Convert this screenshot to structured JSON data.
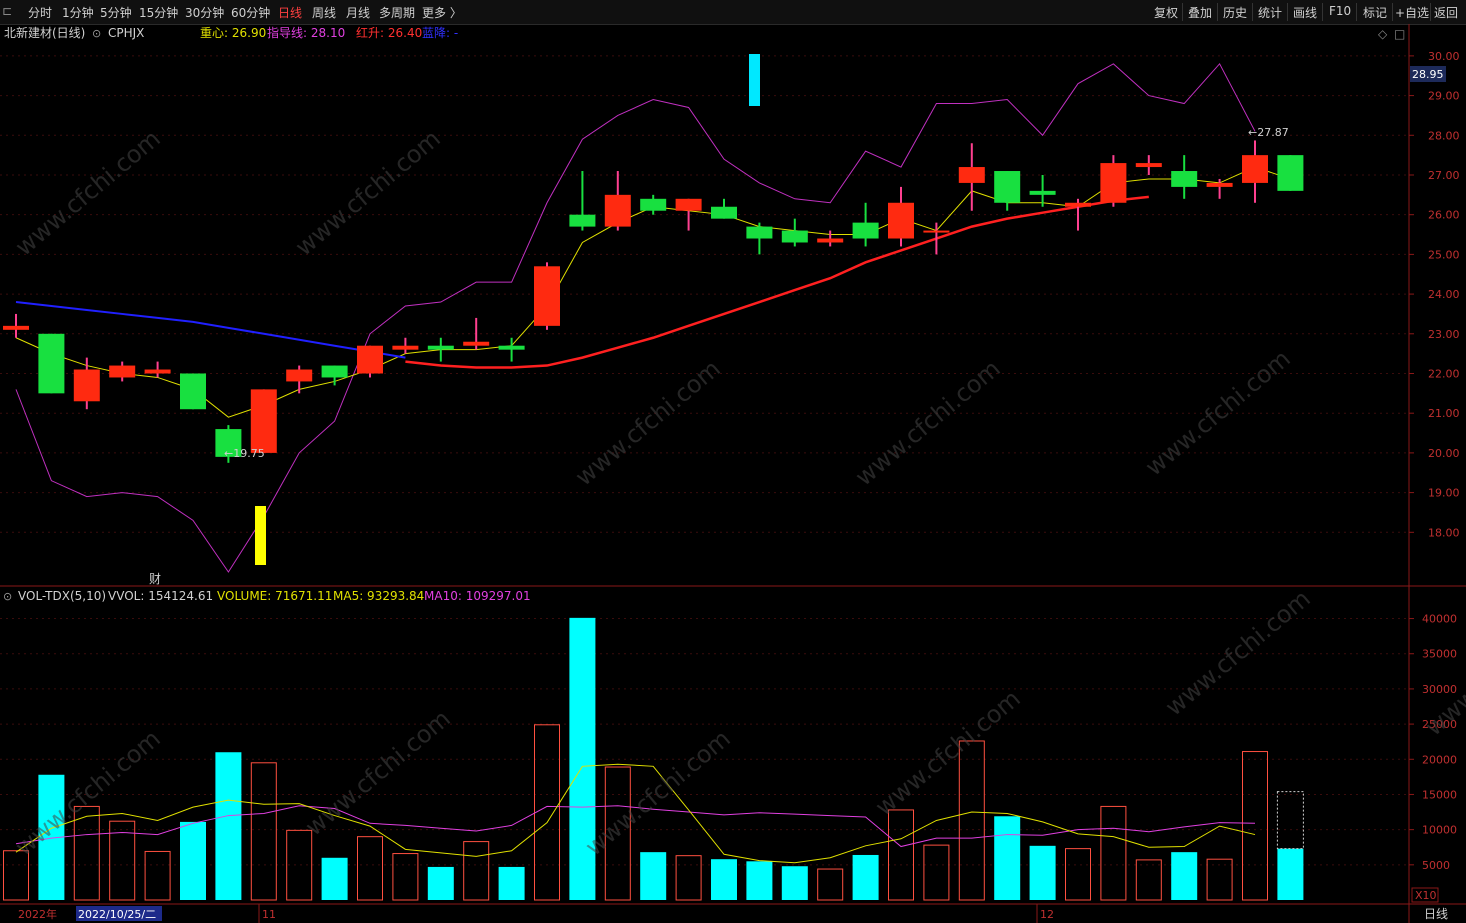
{
  "toolbar": {
    "periods": [
      "分时",
      "1分钟",
      "5分钟",
      "15分钟",
      "30分钟",
      "60分钟",
      "日线",
      "周线",
      "月线",
      "多周期",
      "更多 〉"
    ],
    "active_period": "日线",
    "right_buttons": [
      "复权",
      "叠加",
      "历史",
      "统计",
      "画线",
      "F10",
      "标记",
      "+自选",
      "返回"
    ]
  },
  "main_legend": {
    "stock_name": "北新建材(日线)",
    "indicator": "CPHJX",
    "items": [
      {
        "label": "重心: 26.90",
        "color": "#e0e000"
      },
      {
        "label": "指导线: 28.10",
        "color": "#e040e0"
      },
      {
        "label": "红升: 26.40",
        "color": "#ff3030"
      },
      {
        "label": "蓝降: -",
        "color": "#3030ff"
      }
    ]
  },
  "volume_legend": {
    "name": "VOL-TDX(5,10)",
    "items": [
      {
        "label": "VVOL: 154124.61",
        "color": "#d0d0d0"
      },
      {
        "label": "VOLUME: 71671.11",
        "color": "#e0e000"
      },
      {
        "label": "MA5: 93293.84",
        "color": "#e0e000"
      },
      {
        "label": "MA10: 109297.01",
        "color": "#e040e0"
      }
    ]
  },
  "price_axis": {
    "ticks": [
      "30.00",
      "29.00",
      "28.00",
      "27.00",
      "26.00",
      "25.00",
      "24.00",
      "23.00",
      "22.00",
      "21.00",
      "20.00",
      "19.00",
      "18.00"
    ],
    "current": "28.95"
  },
  "volume_axis": {
    "ticks": [
      "40000",
      "35000",
      "30000",
      "25000",
      "20000",
      "15000",
      "10000",
      "5000"
    ],
    "unit": "X10"
  },
  "date_axis": {
    "labels": [
      "2022年",
      "2022/10/25/二",
      "11",
      "12"
    ],
    "period_label": "日线"
  },
  "annotations": {
    "low": "←19.75",
    "high": "←27.87",
    "finance_marker": "财"
  },
  "watermark": "www.cfchi.com",
  "chart_data": {
    "type": "candlestick",
    "candles": [
      {
        "o": 23.1,
        "h": 23.5,
        "l": 22.9,
        "c": 23.2,
        "v": 7000
      },
      {
        "o": 23.0,
        "h": 23.0,
        "l": 21.5,
        "c": 21.5,
        "v": 17800
      },
      {
        "o": 21.3,
        "h": 22.4,
        "l": 21.1,
        "c": 22.1,
        "v": 13300
      },
      {
        "o": 21.9,
        "h": 22.3,
        "l": 21.8,
        "c": 22.2,
        "v": 11200
      },
      {
        "o": 22.0,
        "h": 22.3,
        "l": 21.9,
        "c": 22.1,
        "v": 6900
      },
      {
        "o": 22.0,
        "h": 22.0,
        "l": 21.1,
        "c": 21.1,
        "v": 11100
      },
      {
        "o": 20.6,
        "h": 20.7,
        "l": 19.75,
        "c": 19.9,
        "v": 21000
      },
      {
        "o": 20.0,
        "h": 21.6,
        "l": 20.0,
        "c": 21.6,
        "v": 19500
      },
      {
        "o": 21.8,
        "h": 22.2,
        "l": 21.5,
        "c": 22.1,
        "v": 9900
      },
      {
        "o": 22.2,
        "h": 22.2,
        "l": 21.7,
        "c": 21.9,
        "v": 6000
      },
      {
        "o": 22.0,
        "h": 22.7,
        "l": 21.9,
        "c": 22.7,
        "v": 9000
      },
      {
        "o": 22.6,
        "h": 22.9,
        "l": 22.5,
        "c": 22.7,
        "v": 6600
      },
      {
        "o": 22.7,
        "h": 22.9,
        "l": 22.3,
        "c": 22.6,
        "v": 4700
      },
      {
        "o": 22.7,
        "h": 23.4,
        "l": 22.6,
        "c": 22.8,
        "v": 8300
      },
      {
        "o": 22.7,
        "h": 22.9,
        "l": 22.3,
        "c": 22.6,
        "v": 4700
      },
      {
        "o": 23.2,
        "h": 24.8,
        "l": 23.1,
        "c": 24.7,
        "v": 24900
      },
      {
        "o": 26.0,
        "h": 27.1,
        "l": 25.6,
        "c": 25.7,
        "v": 40100
      },
      {
        "o": 25.7,
        "h": 27.1,
        "l": 25.6,
        "c": 26.5,
        "v": 18900
      },
      {
        "o": 26.4,
        "h": 26.5,
        "l": 26.0,
        "c": 26.1,
        "v": 6800
      },
      {
        "o": 26.1,
        "h": 26.4,
        "l": 25.6,
        "c": 26.4,
        "v": 6300
      },
      {
        "o": 26.2,
        "h": 26.4,
        "l": 25.9,
        "c": 25.9,
        "v": 5800
      },
      {
        "o": 25.7,
        "h": 25.8,
        "l": 25.0,
        "c": 25.4,
        "v": 5500
      },
      {
        "o": 25.6,
        "h": 25.9,
        "l": 25.2,
        "c": 25.3,
        "v": 4800
      },
      {
        "o": 25.3,
        "h": 25.6,
        "l": 25.2,
        "c": 25.4,
        "v": 4400
      },
      {
        "o": 25.8,
        "h": 26.3,
        "l": 25.2,
        "c": 25.4,
        "v": 6400
      },
      {
        "o": 25.4,
        "h": 26.7,
        "l": 25.2,
        "c": 26.3,
        "v": 12800
      },
      {
        "o": 25.6,
        "h": 25.8,
        "l": 25.0,
        "c": 25.6,
        "v": 7800
      },
      {
        "o": 26.8,
        "h": 27.8,
        "l": 26.1,
        "c": 27.2,
        "v": 22600
      },
      {
        "o": 27.1,
        "h": 27.1,
        "l": 26.1,
        "c": 26.3,
        "v": 11900
      },
      {
        "o": 26.6,
        "h": 27.0,
        "l": 26.2,
        "c": 26.5,
        "v": 7700
      },
      {
        "o": 26.2,
        "h": 26.4,
        "l": 25.6,
        "c": 26.3,
        "v": 7300
      },
      {
        "o": 26.3,
        "h": 27.5,
        "l": 26.2,
        "c": 27.3,
        "v": 13300
      },
      {
        "o": 27.2,
        "h": 27.5,
        "l": 27.0,
        "c": 27.3,
        "v": 5700
      },
      {
        "o": 27.1,
        "h": 27.5,
        "l": 26.4,
        "c": 26.7,
        "v": 6800
      },
      {
        "o": 26.7,
        "h": 26.9,
        "l": 26.4,
        "c": 26.8,
        "v": 5800
      },
      {
        "o": 26.8,
        "h": 27.87,
        "l": 26.3,
        "c": 27.5,
        "v": 21100
      },
      {
        "o": 27.5,
        "h": 27.5,
        "l": 26.6,
        "c": 26.6,
        "v": 7300
      }
    ],
    "vvol_last": 15400,
    "center_line": [
      22.9,
      22.5,
      22.2,
      22.0,
      21.9,
      21.6,
      20.9,
      21.2,
      21.6,
      21.8,
      22.1,
      22.5,
      22.6,
      22.6,
      22.7,
      23.7,
      25.3,
      25.8,
      26.2,
      26.1,
      26.0,
      25.7,
      25.6,
      25.5,
      25.5,
      25.9,
      25.6,
      26.6,
      26.3,
      26.3,
      26.2,
      26.8,
      26.9,
      26.9,
      26.8,
      27.2,
      26.9
    ],
    "guide_line": [
      21.6,
      19.3,
      18.9,
      19.0,
      18.9,
      18.3,
      17.0,
      18.4,
      20.0,
      20.8,
      23.0,
      23.7,
      23.8,
      24.3,
      24.3,
      26.3,
      27.9,
      28.5,
      28.9,
      28.7,
      27.4,
      26.8,
      26.4,
      26.3,
      27.6,
      27.2,
      28.8,
      28.8,
      28.9,
      28.0,
      29.3,
      29.8,
      29.0,
      28.8,
      29.8,
      28.1
    ],
    "blue_line": [
      23.8,
      23.7,
      23.6,
      23.5,
      23.4,
      23.3,
      23.15,
      23.0,
      22.85,
      22.7,
      22.55,
      22.4
    ],
    "red_line": [
      22.3,
      22.2,
      22.15,
      22.15,
      22.2,
      22.4,
      22.65,
      22.9,
      23.2,
      23.5,
      23.8,
      24.1,
      24.4,
      24.8,
      25.1,
      25.4,
      25.7,
      25.9,
      26.05,
      26.2,
      26.35,
      26.45
    ],
    "red_line_start_index": 11,
    "blue_line_end_index": 10,
    "vol_ma5": [
      6800,
      10200,
      11900,
      12300,
      11300,
      13200,
      14200,
      13600,
      13700,
      12000,
      10500,
      7200,
      6700,
      6200,
      7000,
      11000,
      19000,
      19300,
      19000,
      12800,
      6500,
      5600,
      5300,
      6000,
      7700,
      8700,
      11300,
      12500,
      12300,
      11100,
      9400,
      9000,
      7500,
      7600,
      10500,
      9300
    ],
    "vol_ma10": [
      8000,
      8800,
      9300,
      9600,
      9300,
      10900,
      12000,
      12300,
      13400,
      13000,
      10900,
      10600,
      10200,
      9800,
      10600,
      13300,
      13200,
      13400,
      12900,
      12500,
      12100,
      12400,
      12200,
      12000,
      11800,
      7600,
      8800,
      8800,
      9300,
      9200,
      10000,
      10200,
      9700,
      10400,
      11000,
      10900
    ],
    "ylim": [
      17.0,
      30.4
    ],
    "vol_ylim": [
      0,
      41500
    ]
  }
}
